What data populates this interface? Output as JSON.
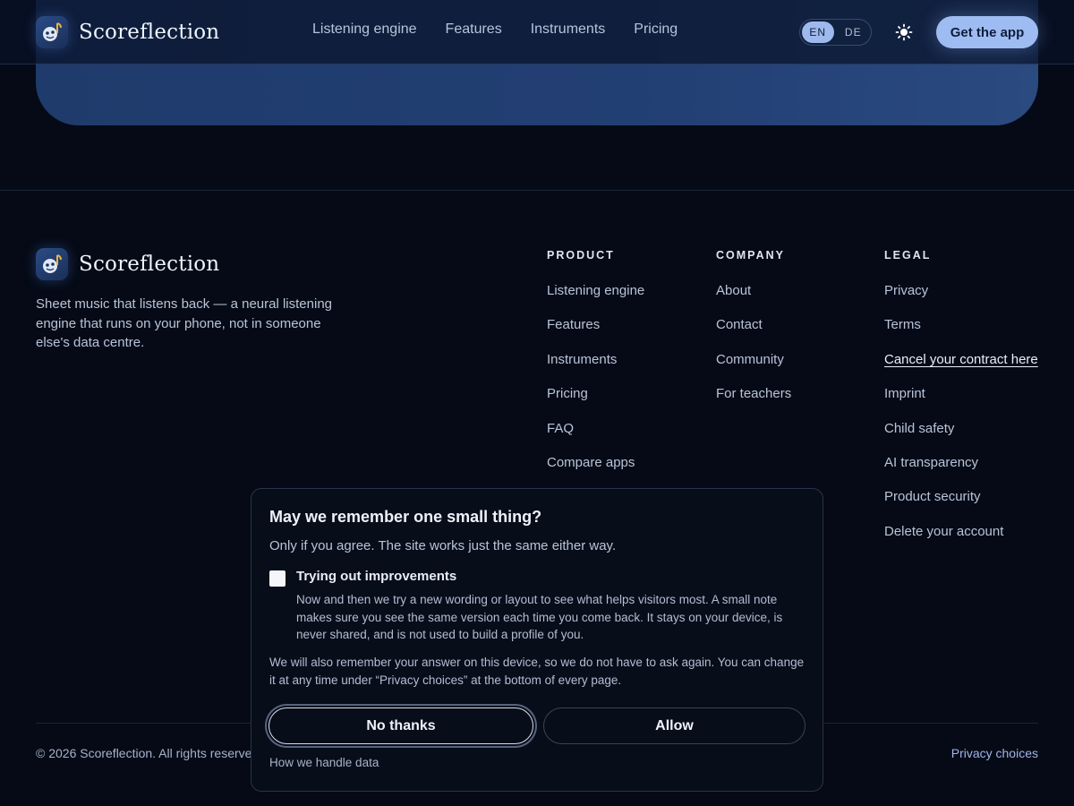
{
  "brand": {
    "name": "Scoreflection",
    "logo_icon": "music-note-face-icon"
  },
  "header": {
    "nav": [
      "Listening engine",
      "Features",
      "Instruments",
      "Pricing"
    ],
    "lang_active": "EN",
    "lang_other": "DE",
    "theme_icon": "sun-icon",
    "cta": "Get the app"
  },
  "footer": {
    "tagline": "Sheet music that listens back — a neural listening engine that runs on your phone, not in someone else's data centre.",
    "columns": [
      {
        "title": "PRODUCT",
        "links": [
          "Listening engine",
          "Features",
          "Instruments",
          "Pricing",
          "FAQ",
          "Compare apps"
        ]
      },
      {
        "title": "COMPANY",
        "links": [
          "About",
          "Contact",
          "Community",
          "For teachers"
        ]
      },
      {
        "title": "LEGAL",
        "links": [
          "Privacy",
          "Terms",
          "Cancel your contract here",
          "Imprint",
          "Child safety",
          "AI transparency",
          "Product security",
          "Delete your account"
        ]
      }
    ],
    "copyright": "© 2026 Scoreflection. All rights reserved.",
    "privacy_choices": "Privacy choices"
  },
  "consent": {
    "title": "May we remember one small thing?",
    "subtitle": "Only if you agree. The site works just the same either way.",
    "option_label": "Trying out improvements",
    "option_checked": false,
    "option_desc": "Now and then we try a new wording or layout to see what helps visitors most. A small note makes sure you see the same version each time you come back. It stays on your device, is never shared, and is not used to build a profile of you.",
    "note": "We will also remember your answer on this device, so we do not have to ask again. You can change it at any time under “Privacy choices” at the bottom of every page.",
    "reject": "No thanks",
    "accept": "Allow",
    "link": "How we handle data"
  },
  "colors": {
    "background": "#050a16",
    "accent": "#9ebcf2",
    "hero": "#1f3b6c"
  }
}
